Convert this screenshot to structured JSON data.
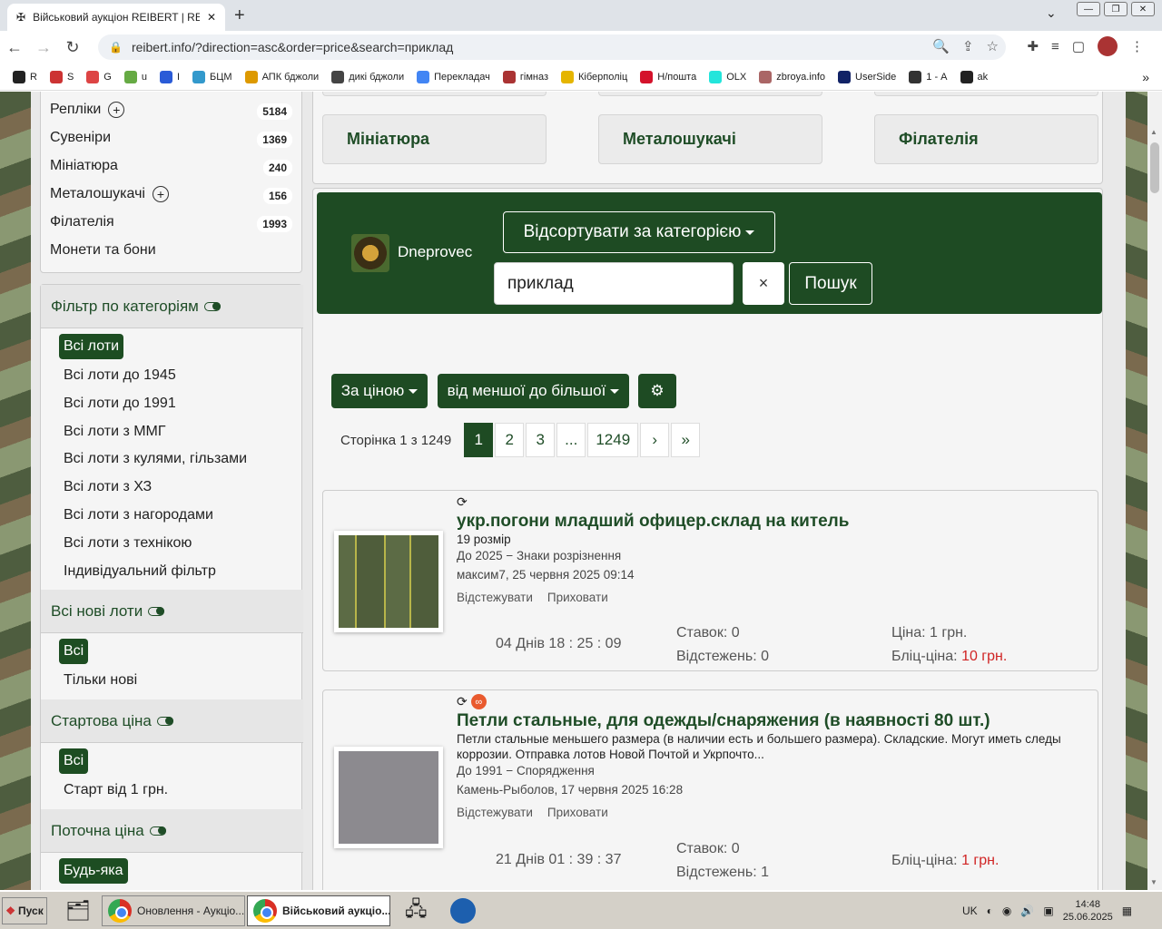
{
  "browser": {
    "tab_title": "Військовий аукціон REIBERT | REI",
    "url": "reibert.info/?direction=asc&order=price&search=приклад",
    "bookmarks": [
      {
        "label": "R",
        "color": "#222"
      },
      {
        "label": "S",
        "color": "#c33"
      },
      {
        "label": "G",
        "color": "#d44"
      },
      {
        "label": "u",
        "color": "#6a4"
      },
      {
        "label": "І",
        "color": "#2a5bd7"
      },
      {
        "label": "БЦМ",
        "color": "#39c"
      },
      {
        "label": "АПК бджоли",
        "color": "#d90"
      },
      {
        "label": "дикі бджоли",
        "color": "#444"
      },
      {
        "label": "Перекладач",
        "color": "#4285f4"
      },
      {
        "label": "гімназ",
        "color": "#a33"
      },
      {
        "label": "Кіберполіц",
        "color": "#e5b500"
      },
      {
        "label": "Н/пошта",
        "color": "#d4122b"
      },
      {
        "label": "OLX",
        "color": "#23e5db"
      },
      {
        "label": "zbroya.info",
        "color": "#a66"
      },
      {
        "label": "UserSide",
        "color": "#126"
      },
      {
        "label": "1 - А",
        "color": "#333"
      },
      {
        "label": "ak",
        "color": "#222"
      }
    ]
  },
  "sidebar": {
    "categories": [
      {
        "label": "Репліки",
        "count": "5184",
        "plus": true
      },
      {
        "label": "Сувеніри",
        "count": "1369",
        "plus": false
      },
      {
        "label": "Мініатюра",
        "count": "240",
        "plus": false
      },
      {
        "label": "Металошукачі",
        "count": "156",
        "plus": true
      },
      {
        "label": "Філателія",
        "count": "1993",
        "plus": false
      },
      {
        "label": "Монети та бони",
        "count": "",
        "plus": false
      }
    ],
    "filter_cat": {
      "title": "Фільтр по категоріям",
      "selected": "Всі лоти",
      "items": [
        "Всі лоти до 1945",
        "Всі лоти до 1991",
        "Всі лоти з ММГ",
        "Всі лоти з кулями, гільзами",
        "Всі лоти з ХЗ",
        "Всі лоти з нагородами",
        "Всі лоти з технікою",
        "Індивідуальний фільтр"
      ]
    },
    "filter_new": {
      "title": "Всі нові лоти",
      "selected": "Всі",
      "items": [
        "Тільки нові"
      ]
    },
    "filter_start": {
      "title": "Стартова ціна",
      "selected": "Всі",
      "items": [
        "Старт від 1 грн."
      ]
    },
    "filter_current": {
      "title": "Поточна ціна",
      "selected": "Будь-яка"
    }
  },
  "main": {
    "top_categories": [
      "Мініатюра",
      "Металошукачі",
      "Філателія"
    ],
    "username": "Dneprovec",
    "sort_category": "Відсортувати за категорією",
    "search_value": "приклад",
    "search_button": "Пошук",
    "clear": "×",
    "sort_by": "За ціною",
    "sort_dir": "від меншої до більшої",
    "pagination": {
      "label": "Сторінка 1 з 1249",
      "pages": [
        "1",
        "2",
        "3",
        "...",
        "1249",
        "›",
        "»"
      ],
      "current": "1"
    },
    "lots": [
      {
        "title": "укр.погони младший офицер.склад на китель",
        "desc": "19 розмір",
        "category": "До 2025 − Знаки розрізнення",
        "seller": "максим7, 25 червня 2025 09:14",
        "track": "Відстежувати",
        "hide": "Приховати",
        "timer": "04 Днів 18 : 25 : 09",
        "bids": "Ставок: 0",
        "tracked": "Відстежень: 0",
        "price": "Ціна: 1 грн.",
        "blitz_label": "Бліц-ціна:",
        "blitz": "10 грн."
      },
      {
        "title": "Петли стальные, для одежды/снаряжения (в наявності 80 шт.)",
        "desc": "Петли стальные меньшего размера (в наличии есть и большего размера). Складские. Могут иметь следы коррозии. Отправка лотов Новой Почтой и Укрпочто...",
        "category": "До 1991 − Спорядження",
        "seller": "Камень-Рыболов, 17 червня 2025 16:28",
        "track": "Відстежувати",
        "hide": "Приховати",
        "timer": "21 Днів 01 : 39 : 37",
        "bids": "Ставок: 0",
        "tracked": "Відстежень: 1",
        "price": "",
        "blitz_label": "Бліц-ціна:",
        "blitz": "1 грн."
      }
    ]
  },
  "taskbar": {
    "start": "Пуск",
    "item1": "Оновлення - Аукціо...",
    "item2": "Військовий аукціо...",
    "lang": "UK",
    "time": "14:48",
    "date": "25.06.2025"
  }
}
